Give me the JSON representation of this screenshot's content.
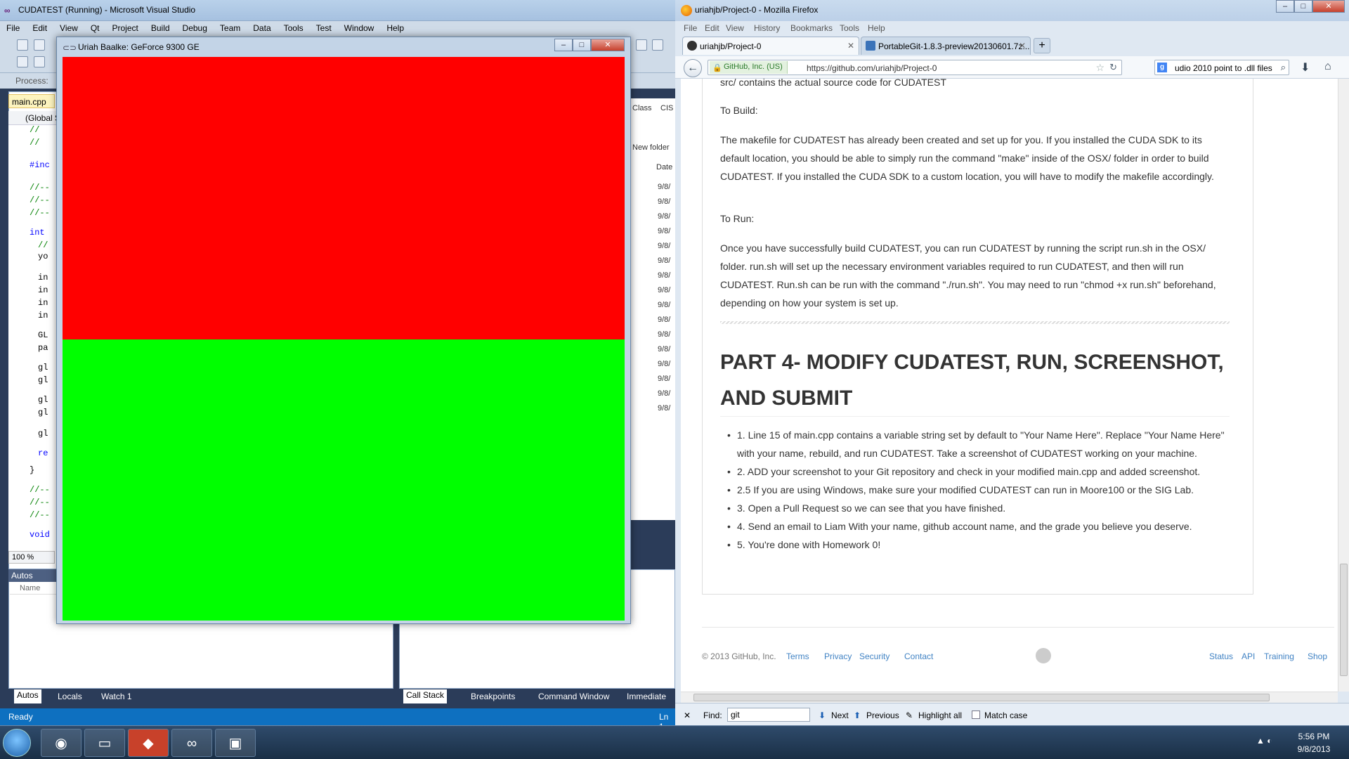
{
  "vs": {
    "title": "CUDATEST (Running) - Microsoft Visual Studio",
    "menu": [
      "File",
      "Edit",
      "View",
      "Qt",
      "Project",
      "Build",
      "Debug",
      "Team",
      "Data",
      "Tools",
      "Test",
      "Window",
      "Help"
    ],
    "process_label": "Process:",
    "doc_tab": "main.cpp",
    "scope": "(Global S",
    "code_lines": [
      "//",
      "//",
      "#inc",
      "//--",
      "//--",
      "//--",
      "int",
      "//",
      "yo",
      "in",
      "in",
      "in",
      "in",
      "GL",
      "pa",
      "gl",
      "gl",
      "gl",
      "gl",
      "gl",
      "re",
      "}",
      "//--",
      "//--",
      "//--",
      "void"
    ],
    "zoom": "100 %",
    "right_panel": {
      "breadcrumb_a": "Class",
      "breadcrumb_b": "CIS",
      "new_folder": "New folder",
      "date_col": "Date",
      "dates": [
        "9/8/",
        "9/8/",
        "9/8/",
        "9/8/",
        "9/8/",
        "9/8/",
        "9/8/",
        "9/8/",
        "9/8/",
        "9/8/",
        "9/8/",
        "9/8/",
        "9/8/",
        "9/8/",
        "9/8/",
        "9/8/"
      ]
    },
    "autos_title": "Autos",
    "autos_col": "Name",
    "bottom_tabs": [
      "Autos",
      "Locals",
      "Watch 1",
      "Call Stack",
      "Breakpoints",
      "Command Window",
      "Immediate"
    ],
    "status_left": "Ready",
    "status_right": "Ln 1"
  },
  "gl_window": {
    "title": "Uriah Baalke: GeForce 9300 GE",
    "top_color": "#ff0000",
    "bottom_color": "#00ff00"
  },
  "ff": {
    "title": "uriahjb/Project-0 - Mozilla Firefox",
    "menu": [
      "File",
      "Edit",
      "View",
      "History",
      "Bookmarks",
      "Tools",
      "Help"
    ],
    "tabs": [
      {
        "label": "uriahjb/Project-0",
        "selected": true
      },
      {
        "label": "PortableGit-1.8.3-preview20130601.7z...",
        "selected": false
      }
    ],
    "identity": "GitHub, Inc. (US)",
    "url": "https://github.com/uriahjb/Project-0",
    "search_query": "udio 2010 point to .dll files",
    "page": {
      "cutoff_line": "src/ contains the actual source code for CUDATEST",
      "to_build": "To Build:",
      "build_text": "The makefile for CUDATEST has already been created and set up for you. If you installed the CUDA SDK to its default location, you should be able to simply run the command \"make\" inside of the OSX/ folder in order to build CUDATEST. If you installed the CUDA SDK to a custom location, you will have to modify the makefile accordingly.",
      "to_run": "To Run:",
      "run_text": "Once you have successfully build CUDATEST, you can run CUDATEST by running the script run.sh in the OSX/ folder. run.sh will set up the necessary environment variables required to run CUDATEST, and then will run CUDATEST. Run.sh can be run with the command \"./run.sh\". You may need to run \"chmod +x run.sh\" beforehand, depending on how your system is set up.",
      "heading": "PART 4- MODIFY CUDATEST, RUN, SCREENSHOT, AND SUBMIT",
      "steps": [
        "1. Line 15 of main.cpp contains a variable string set by default to \"Your Name Here\". Replace \"Your Name Here\" with your name, rebuild, and run CUDATEST. Take a screenshot of CUDATEST working on your machine.",
        "2. ADD your screenshot to your Git repository and check in your modified main.cpp and added screenshot.",
        "2.5 If you are using Windows, make sure your modified CUDATEST can run in Moore100 or the SIG Lab.",
        "3. Open a Pull Request so we can see that you have finished.",
        "4. Send an email to Liam With your name, github account name, and the grade you believe you deserve.",
        "5. You're done with Homework 0!"
      ],
      "footer_left": [
        "© 2013 GitHub, Inc.",
        "Terms",
        "Privacy",
        "Security",
        "Contact"
      ],
      "footer_right": [
        "Status",
        "API",
        "Training",
        "Shop"
      ]
    },
    "find": {
      "label": "Find:",
      "value": "git",
      "next": "Next",
      "previous": "Previous",
      "highlight": "Highlight all",
      "match_case": "Match case"
    }
  },
  "taskbar": {
    "time": "5:56 PM",
    "date": "9/8/2013"
  },
  "colors": {
    "link": "#4183c4",
    "vs_status": "#0e70c0"
  }
}
